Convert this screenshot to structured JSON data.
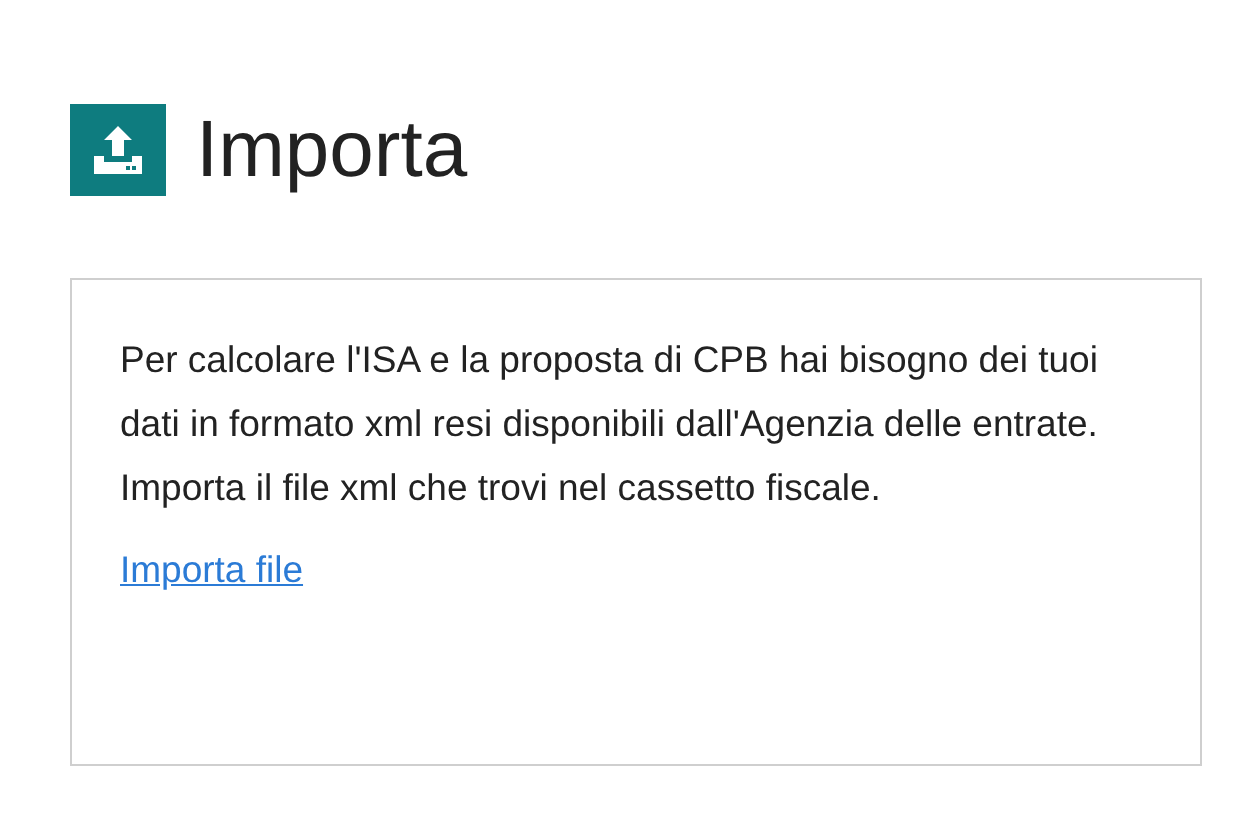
{
  "header": {
    "title": "Importa"
  },
  "card": {
    "message": "Per calcolare l'ISA e la proposta di CPB hai bisogno dei tuoi dati in formato xml resi disponibili dall'Agenzia delle entrate. Importa il file xml che trovi nel cassetto fiscale.",
    "link": "Importa file"
  }
}
